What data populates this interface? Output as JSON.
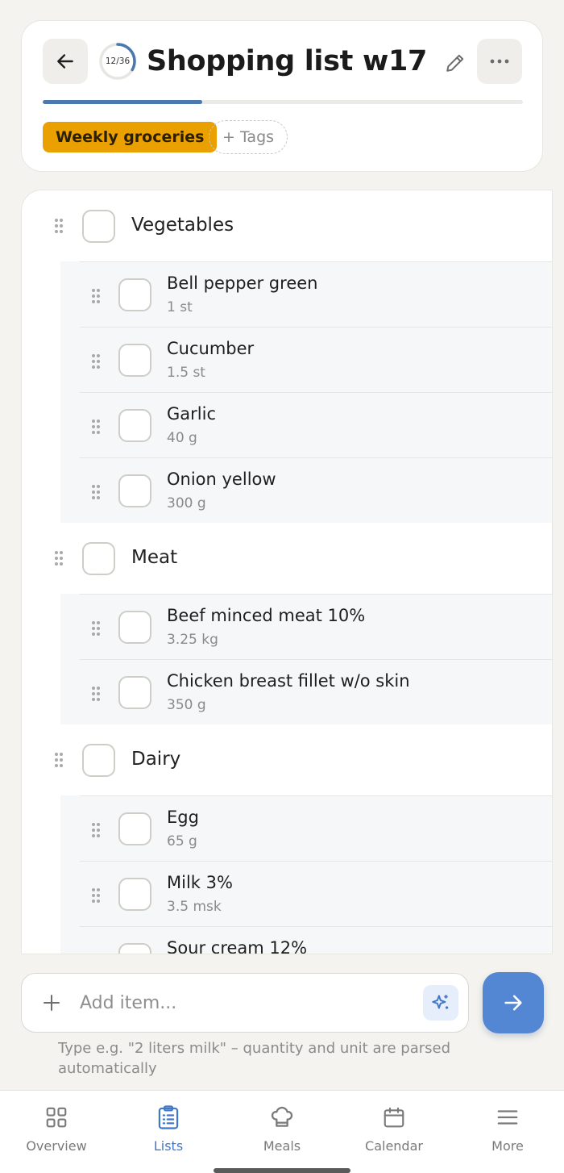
{
  "header": {
    "title": "Shopping list w17",
    "progress_text": "12/36",
    "progress_fraction": 0.333,
    "tag": "Weekly groceries",
    "tags_add_label": "+ Tags"
  },
  "categories": [
    {
      "name": "Vegetables",
      "items": [
        {
          "name": "Bell pepper green",
          "qty": "1 st"
        },
        {
          "name": "Cucumber",
          "qty": "1.5 st"
        },
        {
          "name": "Garlic",
          "qty": "40 g"
        },
        {
          "name": "Onion yellow",
          "qty": "300 g"
        }
      ]
    },
    {
      "name": "Meat",
      "items": [
        {
          "name": "Beef minced meat 10%",
          "qty": "3.25 kg"
        },
        {
          "name": "Chicken breast fillet w/o skin",
          "qty": "350 g"
        }
      ]
    },
    {
      "name": "Dairy",
      "items": [
        {
          "name": "Egg",
          "qty": "65 g"
        },
        {
          "name": "Milk 3%",
          "qty": "3.5 msk"
        },
        {
          "name": "Sour cream 12%",
          "qty": ""
        }
      ]
    }
  ],
  "composer": {
    "placeholder": "Add item...",
    "hint": "Type e.g. \"2 liters milk\" – quantity and unit are parsed automatically"
  },
  "nav": {
    "items": [
      {
        "label": "Overview",
        "icon": "grid-icon"
      },
      {
        "label": "Lists",
        "icon": "clipboard-list-icon",
        "active": true
      },
      {
        "label": "Meals",
        "icon": "chef-hat-icon"
      },
      {
        "label": "Calendar",
        "icon": "calendar-icon"
      },
      {
        "label": "More",
        "icon": "menu-icon"
      }
    ]
  },
  "colors": {
    "accent": "#4b78ae",
    "tag": "#e9a000",
    "send_button": "#5487d3",
    "active_nav": "#3f78c8"
  }
}
